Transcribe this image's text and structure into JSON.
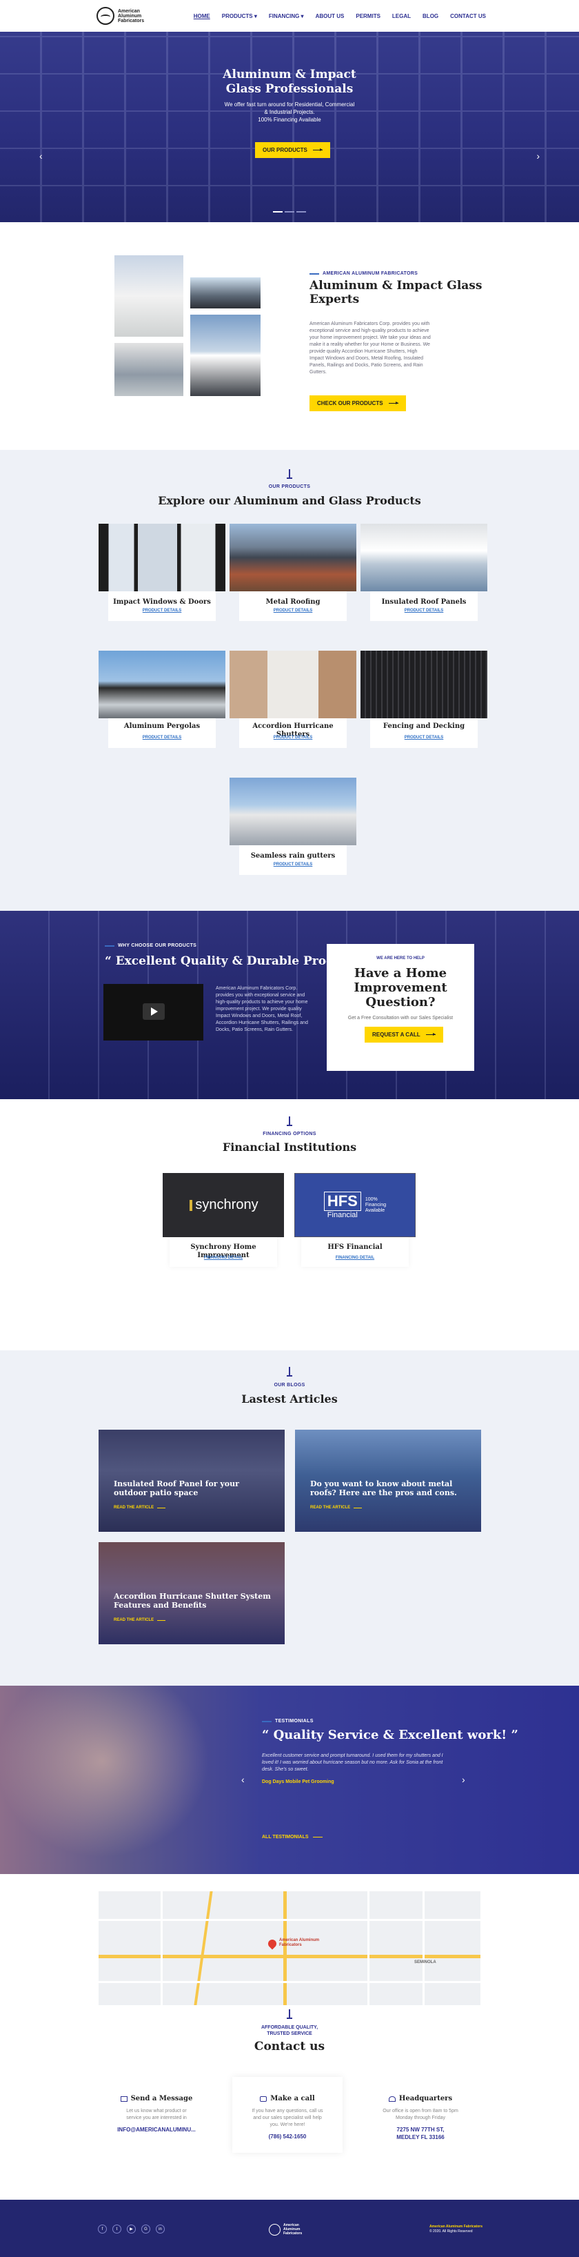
{
  "header": {
    "logo_text": "American Aluminum Fabricators",
    "nav": [
      "HOME",
      "PRODUCTS ▾",
      "FINANCING ▾",
      "ABOUT US",
      "PERMITS",
      "LEGAL",
      "BLOG",
      "CONTACT US"
    ]
  },
  "hero": {
    "title": "Aluminum & Impact\nGlass Professionals",
    "subtitle": "We offer fast turn around for Residential, Commercial\n& Industrial Projects.\n100% Financing Available",
    "button": "OUR PRODUCTS",
    "prev": "‹",
    "next": "›"
  },
  "about": {
    "eyebrow": "AMERICAN ALUMINUM FABRICATORS",
    "title": "Aluminum & Impact Glass\nExperts",
    "body": "American Aluminum Fabricators Corp. provides you with exceptional service and high-quality products to achieve your home improvement project. We take your ideas and make it a reality whether for your Home or Business. We provide quality Accordion Hurricane Shutters, High Impact Windows and Doors, Metal Roofing, Insulated Panels, Railings and Docks, Patio Screens, and Rain Gutters.",
    "button": "CHECK OUR PRODUCTS"
  },
  "products": {
    "eyebrow": "OUR PRODUCTS",
    "title": "Explore our Aluminum and Glass Products",
    "link_label": "PRODUCT DETAILS",
    "items": [
      {
        "title": "Impact Windows & Doors"
      },
      {
        "title": "Metal Roofing"
      },
      {
        "title": "Insulated Roof Panels"
      },
      {
        "title": "Aluminum Pergolas"
      },
      {
        "title": "Accordion Hurricane\nShutters"
      },
      {
        "title": "Fencing and Decking"
      },
      {
        "title": "Seamless rain gutters"
      }
    ]
  },
  "quality": {
    "eyebrow": "WHY CHOOSE OUR PRODUCTS",
    "title": "“ Excellent Quality & Durable Products! ”",
    "body": "American Aluminum Fabricators Corp. provides you with exceptional service and high-quality products to achieve your home improvement project. We provide quality Impact Windows and Doors, Metal Roof, Accordion Hurricane Shutters, Railings and Docks, Patio Screens, Rain Gutters.",
    "box_eyebrow": "WE ARE HERE TO HELP",
    "box_title": "Have a Home\nImprovement\nQuestion?",
    "box_sub": "Get a Free Consultation with our Sales Specialist",
    "box_button": "REQUEST A CALL"
  },
  "financing": {
    "eyebrow": "FINANCING OPTIONS",
    "title": "Financial Institutions",
    "link_label": "FINANCING DETAIL",
    "items": [
      {
        "title": "Synchrony Home\nImprovement",
        "logo": "synchrony"
      },
      {
        "title": "HFS Financial",
        "logo": "HFS",
        "logo_sub": "Financial",
        "logo_side": "100%\nFinancing\nAvailable"
      }
    ]
  },
  "blog": {
    "eyebrow": "OUR BLOGS",
    "title": "Lastest Articles",
    "more": "READ THE ARTICLE",
    "posts": [
      {
        "title": "Insulated Roof Panel for your outdoor patio space"
      },
      {
        "title": "Do you want to know about metal roofs? Here are the pros and cons."
      },
      {
        "title": "Accordion Hurricane Shutter System Features and Benefits"
      }
    ]
  },
  "testimonials": {
    "eyebrow": "TESTIMONIALS",
    "title": "“ Quality Service & Excellent work! ”",
    "quote": "Excellent customer service and prompt turnaround. I used them for my shutters and I loved it! I was worried about hurricane season but no more. Ask for Sonia at the front desk. She's so sweet.",
    "author": "Dog Days Mobile Pet Grooming",
    "all": "ALL TESTIMONIALS",
    "prev": "‹",
    "next": "›"
  },
  "contact": {
    "map": {
      "pin_label": "American Aluminum\nFabricators",
      "city": "SEMINOLA"
    },
    "affordable": "AFFORDABLE QUALITY,\nTRUSTED SERVICE",
    "title": "Contact us",
    "boxes": [
      {
        "title": "Send a Message",
        "text": "Let us know what product or\nservice you are interested in",
        "value": "INFO@AMERICANALUMINU..."
      },
      {
        "title": "Make a call",
        "text": "If you have any questions, call us\nand our sales specialist will help\nyou. We're here!",
        "value": "(786) 542-1650"
      },
      {
        "title": "Headquarters",
        "text": "Our office is open from 8am to 5pm\nMonday through Friday",
        "value": "7275 NW 77TH ST,\nMEDLEY FL 33166"
      }
    ]
  },
  "footer": {
    "social": [
      "f",
      "t",
      "▶",
      "G",
      "in"
    ],
    "logo_text": "American Aluminum Fabricators",
    "company": "American Aluminum Fabricators",
    "copyright": "© 2020. All Rights Reserved"
  },
  "colors": {
    "brand": "#2e3192",
    "accent": "#ffd600",
    "link": "#2e6fc5",
    "light_bg": "#eef1f7"
  }
}
